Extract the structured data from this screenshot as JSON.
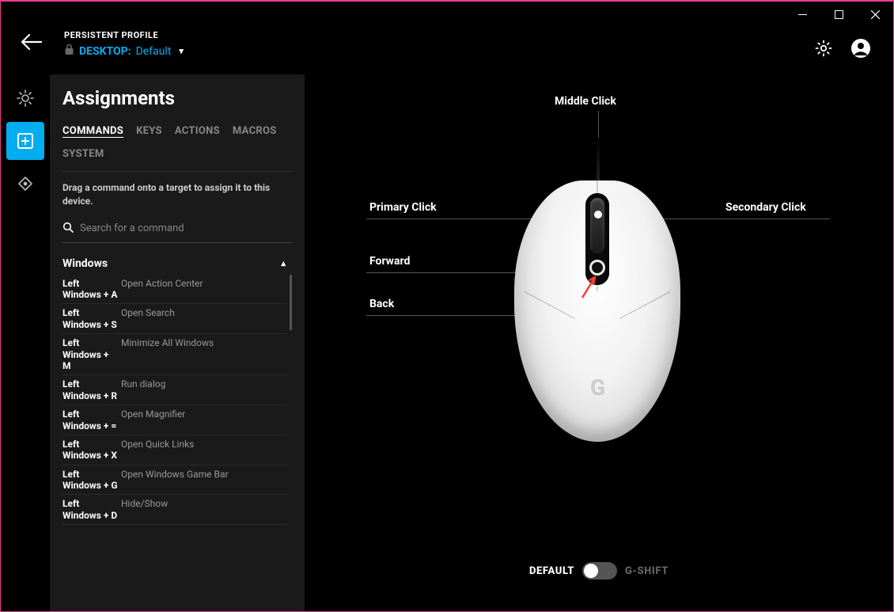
{
  "header": {
    "profile_label": "PERSISTENT PROFILE",
    "profile_prefix": "DESKTOP:",
    "profile_name": "Default"
  },
  "rail": {
    "items": [
      "brightness",
      "new",
      "sensitivity"
    ]
  },
  "panel": {
    "title": "Assignments",
    "tabs": [
      "COMMANDS",
      "KEYS",
      "ACTIONS",
      "MACROS",
      "SYSTEM"
    ],
    "active_tab": 0,
    "hint": "Drag a command onto a target to assign it to this device.",
    "search_placeholder": "Search for a command",
    "section": "Windows",
    "commands": [
      {
        "key": "Left Windows + A",
        "desc": "Open Action Center"
      },
      {
        "key": "Left Windows + S",
        "desc": "Open Search"
      },
      {
        "key": "Left Windows + M",
        "desc": "Minimize All Windows"
      },
      {
        "key": "Left Windows + R",
        "desc": "Run dialog"
      },
      {
        "key": "Left Windows + =",
        "desc": "Open Magnifier"
      },
      {
        "key": "Left Windows + X",
        "desc": "Open Quick Links"
      },
      {
        "key": "Left Windows + G",
        "desc": "Open Windows Game Bar"
      },
      {
        "key": "Left Windows + D",
        "desc": "Hide/Show"
      }
    ]
  },
  "mouse_labels": {
    "middle": "Middle Click",
    "primary": "Primary Click",
    "secondary": "Secondary Click",
    "forward": "Forward",
    "back": "Back"
  },
  "toggle": {
    "default": "DEFAULT",
    "gshift": "G-SHIFT"
  },
  "colors": {
    "accent": "#00aeef",
    "window_border": "#e83e8c",
    "arrow": "#ff3b30"
  }
}
